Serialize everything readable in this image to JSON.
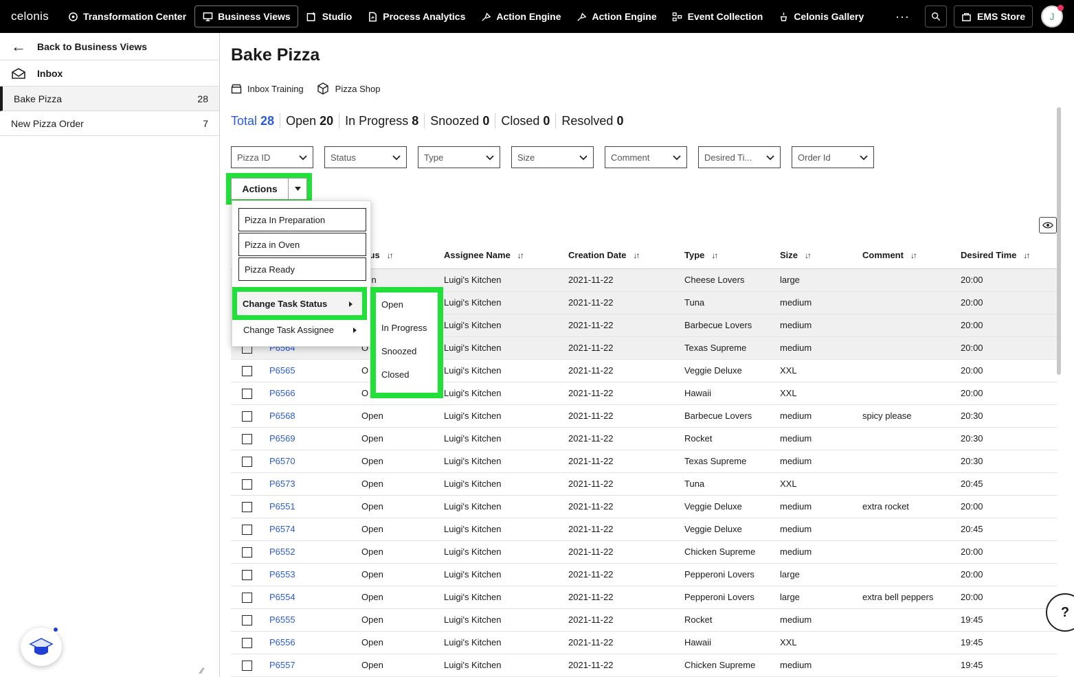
{
  "topbar": {
    "logo": "celonis",
    "nav": [
      {
        "label": "Transformation Center",
        "icon": "transformation-icon",
        "active": false
      },
      {
        "label": "Business Views",
        "icon": "business-views-icon",
        "active": true
      },
      {
        "label": "Studio",
        "icon": "studio-icon",
        "active": false
      },
      {
        "label": "Process Analytics",
        "icon": "process-analytics-icon",
        "active": false
      },
      {
        "label": "Action Engine",
        "icon": "action-engine-icon",
        "active": false
      },
      {
        "label": "Action Engine",
        "icon": "action-engine-icon",
        "active": false
      },
      {
        "label": "Event Collection",
        "icon": "event-collection-icon",
        "active": false
      },
      {
        "label": "Celonis Gallery",
        "icon": "gallery-icon",
        "active": false
      }
    ],
    "more": "···",
    "ems_store": "EMS Store",
    "avatar_initial": "J"
  },
  "sidebar": {
    "back_label": "Back to Business Views",
    "inbox_label": "Inbox",
    "items": [
      {
        "label": "Bake Pizza",
        "count": "28"
      },
      {
        "label": "New Pizza Order",
        "count": "7"
      }
    ]
  },
  "main": {
    "title": "Bake Pizza",
    "crumbs": [
      "Inbox Training",
      "Pizza Shop"
    ],
    "stats": [
      {
        "label": "Total",
        "value": "28"
      },
      {
        "label": "Open",
        "value": "20"
      },
      {
        "label": "In Progress",
        "value": "8"
      },
      {
        "label": "Snoozed",
        "value": "0"
      },
      {
        "label": "Closed",
        "value": "0"
      },
      {
        "label": "Resolved",
        "value": "0"
      }
    ],
    "filters": [
      "Pizza ID",
      "Status",
      "Type",
      "Size",
      "Comment",
      "Desired Ti...",
      "Order Id"
    ],
    "actions_label": "Actions"
  },
  "menu": {
    "options": [
      "Pizza In Preparation",
      "Pizza in Oven",
      "Pizza Ready"
    ],
    "change_status": "Change Task Status",
    "change_assignee": "Change Task Assignee",
    "status_options": [
      "Open",
      "In Progress",
      "Snoozed",
      "Closed"
    ]
  },
  "table": {
    "headers": [
      "atus",
      "Assignee Name",
      "Creation Date",
      "Type",
      "Size",
      "Comment",
      "Desired Time"
    ],
    "rows": [
      {
        "id": "",
        "status": "pen",
        "assignee": "Luigi's Kitchen",
        "date": "2021-11-22",
        "type": "Cheese Lovers",
        "size": "large",
        "comment": "",
        "time": "20:00",
        "selected": true
      },
      {
        "id": "",
        "status": "",
        "assignee": "Luigi's Kitchen",
        "date": "2021-11-22",
        "type": "Tuna",
        "size": "medium",
        "comment": "",
        "time": "20:00",
        "selected": true
      },
      {
        "id": "",
        "status": "",
        "assignee": "Luigi's Kitchen",
        "date": "2021-11-22",
        "type": "Barbecue Lovers",
        "size": "medium",
        "comment": "",
        "time": "20:00",
        "selected": true
      },
      {
        "id": "P6564",
        "status": "O",
        "assignee": "Luigi's Kitchen",
        "date": "2021-11-22",
        "type": "Texas Supreme",
        "size": "medium",
        "comment": "",
        "time": "20:00",
        "selected": true
      },
      {
        "id": "P6565",
        "status": "O",
        "assignee": "Luigi's Kitchen",
        "date": "2021-11-22",
        "type": "Veggie Deluxe",
        "size": "XXL",
        "comment": "",
        "time": "20:00",
        "selected": false
      },
      {
        "id": "P6566",
        "status": "O",
        "assignee": "Luigi's Kitchen",
        "date": "2021-11-22",
        "type": "Hawaii",
        "size": "XXL",
        "comment": "",
        "time": "20:00",
        "selected": false
      },
      {
        "id": "P6568",
        "status": "Open",
        "assignee": "Luigi's Kitchen",
        "date": "2021-11-22",
        "type": "Barbecue Lovers",
        "size": "medium",
        "comment": "spicy please",
        "time": "20:30",
        "selected": false
      },
      {
        "id": "P6569",
        "status": "Open",
        "assignee": "Luigi's Kitchen",
        "date": "2021-11-22",
        "type": "Rocket",
        "size": "medium",
        "comment": "",
        "time": "20:30",
        "selected": false
      },
      {
        "id": "P6570",
        "status": "Open",
        "assignee": "Luigi's Kitchen",
        "date": "2021-11-22",
        "type": "Texas Supreme",
        "size": "medium",
        "comment": "",
        "time": "20:30",
        "selected": false
      },
      {
        "id": "P6573",
        "status": "Open",
        "assignee": "Luigi's Kitchen",
        "date": "2021-11-22",
        "type": "Tuna",
        "size": "XXL",
        "comment": "",
        "time": "20:45",
        "selected": false
      },
      {
        "id": "P6551",
        "status": "Open",
        "assignee": "Luigi's Kitchen",
        "date": "2021-11-22",
        "type": "Veggie Deluxe",
        "size": "medium",
        "comment": "extra rocket",
        "time": "20:00",
        "selected": false
      },
      {
        "id": "P6574",
        "status": "Open",
        "assignee": "Luigi's Kitchen",
        "date": "2021-11-22",
        "type": "Veggie Deluxe",
        "size": "medium",
        "comment": "",
        "time": "20:45",
        "selected": false
      },
      {
        "id": "P6552",
        "status": "Open",
        "assignee": "Luigi's Kitchen",
        "date": "2021-11-22",
        "type": "Chicken Supreme",
        "size": "medium",
        "comment": "",
        "time": "20:00",
        "selected": false
      },
      {
        "id": "P6553",
        "status": "Open",
        "assignee": "Luigi's Kitchen",
        "date": "2021-11-22",
        "type": "Pepperoni Lovers",
        "size": "large",
        "comment": "",
        "time": "20:00",
        "selected": false
      },
      {
        "id": "P6554",
        "status": "Open",
        "assignee": "Luigi's Kitchen",
        "date": "2021-11-22",
        "type": "Pepperoni Lovers",
        "size": "large",
        "comment": "extra bell peppers",
        "time": "20:00",
        "selected": false
      },
      {
        "id": "P6555",
        "status": "Open",
        "assignee": "Luigi's Kitchen",
        "date": "2021-11-22",
        "type": "Rocket",
        "size": "medium",
        "comment": "",
        "time": "19:45",
        "selected": false
      },
      {
        "id": "P6556",
        "status": "Open",
        "assignee": "Luigi's Kitchen",
        "date": "2021-11-22",
        "type": "Hawaii",
        "size": "XXL",
        "comment": "",
        "time": "19:45",
        "selected": false
      },
      {
        "id": "P6557",
        "status": "Open",
        "assignee": "Luigi's Kitchen",
        "date": "2021-11-22",
        "type": "Chicken Supreme",
        "size": "medium",
        "comment": "",
        "time": "19:45",
        "selected": false
      }
    ]
  },
  "colors": {
    "accent": "#2b5bd7",
    "highlight": "#22e03a",
    "topbar": "#000000"
  }
}
